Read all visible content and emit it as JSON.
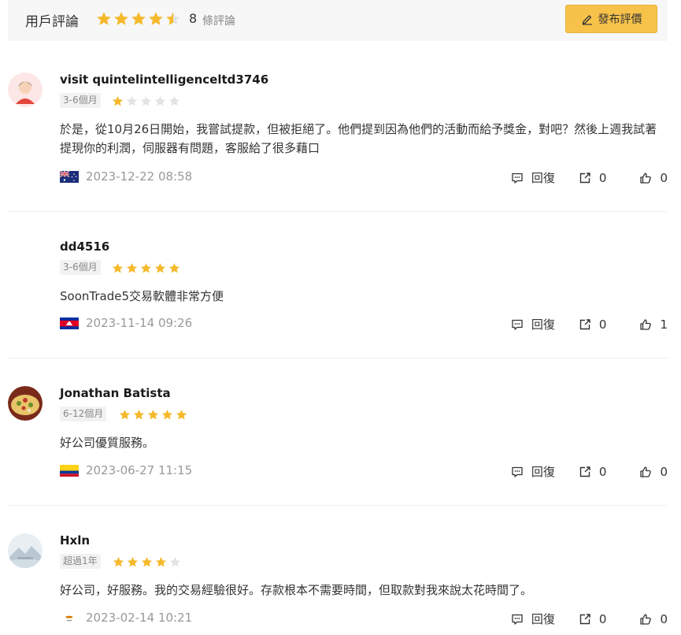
{
  "header": {
    "title": "用戶評論",
    "rating": 4.5,
    "count": "8",
    "count_label": "條評論",
    "post_button": "發布評價"
  },
  "colors": {
    "star_on": "#f5b92b",
    "star_off": "#e3e3e3",
    "accent": "#f7c24a"
  },
  "reviews": [
    {
      "user": "visit quintelintelligenceltd3746",
      "period": "3-6個月",
      "stars": 1,
      "content": "於是，從10月26日開始，我嘗試提款，但被拒絕了。他們提到因為他們的活動而給予獎金，對吧？然後上週我試著提現你的利潤，伺服器有問題，客服給了很多藉口",
      "flag": "australia-flag",
      "date": "2023-12-22 08:58",
      "reply_label": "回復",
      "shares": "0",
      "likes": "0"
    },
    {
      "user": "dd4516",
      "period": "3-6個月",
      "stars": 5,
      "content": "SoonTrade5交易軟體非常方便",
      "flag": "cambodia-flag",
      "date": "2023-11-14 09:26",
      "reply_label": "回復",
      "shares": "0",
      "likes": "1"
    },
    {
      "user": "Jonathan Batista",
      "period": "6-12個月",
      "stars": 5,
      "content": "好公司優質服務。",
      "flag": "colombia-flag",
      "date": "2023-06-27 11:15",
      "reply_label": "回復",
      "shares": "0",
      "likes": "0"
    },
    {
      "user": "Hxln",
      "period": "超過1年",
      "stars": 4,
      "content": "好公司，好服務。我的交易經驗很好。存款根本不需要時間，但取款對我來說太花時間了。",
      "flag": "cyprus-flag",
      "date": "2023-02-14 10:21",
      "reply_label": "回復",
      "shares": "0",
      "likes": "0"
    }
  ]
}
